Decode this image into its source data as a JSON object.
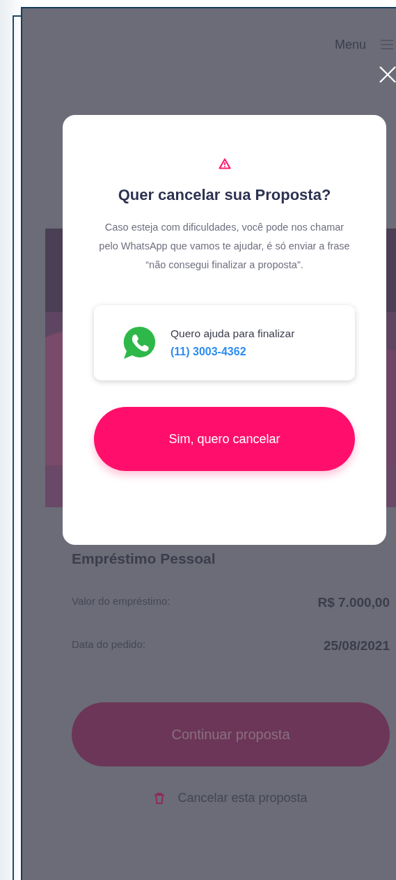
{
  "header": {
    "menu_label": "Menu"
  },
  "loan": {
    "title": "Empréstimo Pessoal",
    "rows": [
      {
        "label": "Valor do empréstimo:",
        "value": "R$ 7.000,00"
      },
      {
        "label": "Data do pedido:",
        "value": "25/08/2021"
      }
    ],
    "continue_button": "Continuar proposta",
    "cancel_link": "Cancelar esta proposta"
  },
  "modal": {
    "title": "Quer cancelar sua Proposta?",
    "text": "Caso esteja com dificuldades, você pode nos chamar pelo WhatsApp que vamos te ajudar, é só enviar a frase “não consegui finalizar a proposta”.",
    "help_label": "Quero ajuda para finalizar",
    "help_phone": "(11) 3003-4362",
    "confirm_button": "Sim, quero cancelar"
  }
}
